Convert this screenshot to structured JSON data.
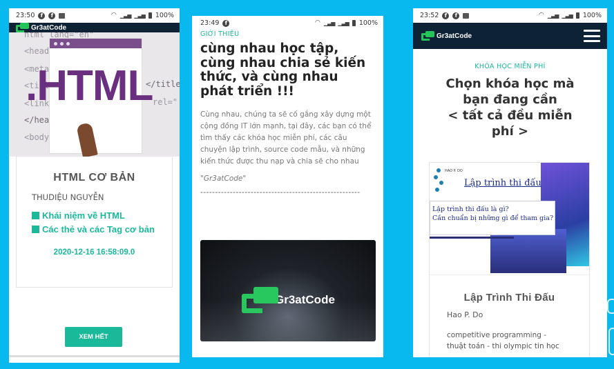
{
  "phone1": {
    "status": {
      "time": "23:50",
      "battery": "100%"
    },
    "brand": "Gr3atCode",
    "hero": {
      "big_text": ".HTML",
      "code_lines": [
        "html lang=\"en\"",
        "<head>",
        "<meta",
        "<title",
        "<link",
        "</head>",
        "<body",
        "</title",
        "rel=\""
      ]
    },
    "card": {
      "title": "HTML CƠ BẢN",
      "author": "THUDIỆU NGUYỄN",
      "links": [
        "Khái niệm về HTML",
        "Các thẻ và các Tag cơ bản"
      ],
      "date": "2020-12-16 16:58:09.0"
    },
    "more_button": "XEM HẾT"
  },
  "phone2": {
    "status": {
      "time": "23:49",
      "battery": "100%"
    },
    "section_label": "GIỚI THIỆU",
    "title": "cùng nhau học tập, cùng nhau chia sẻ kiến thức, và cùng nhau phát triển !!!",
    "paragraph": "Cùng nhau, chúng ta sẽ cố gắng xây dựng một cộng đồng IT lớn mạnh, tại đây, các bạn có thể tìm thấy các khóa học miễn phí, các câu chuyện lập trình, source code mẫu, và những kiến thức được thu nạp và chia sẽ cho nhau",
    "quote": "\"Gr3atCode\"",
    "divider": "------------------------------------------------------",
    "image_logo": "Gr3atCode"
  },
  "phone3": {
    "status": {
      "time": "23:52",
      "battery": "100%"
    },
    "brand": "Gr3atCode",
    "section_label": "KHÓA HỌC MIỄN PHÍ",
    "title_lines": [
      "Chọn khóa học mà",
      "bạn đang cần",
      "< tất cả đều miễn",
      "phí >"
    ],
    "card": {
      "image_brand": "HAO P. DO",
      "image_title": "Lập trình thi đấu",
      "image_question_1": "Lập trình thi đấu là gì?",
      "image_question_2": "Cần chuẩn bị những gì để tham gia?",
      "title": "Lập Trình Thi Đấu",
      "author": "Hao P. Do",
      "desc_1": "competitive programming -",
      "desc_2": "thuật toán - thi olympic tin học"
    }
  },
  "colors": {
    "background": "#07b9ee",
    "accent": "#19b99a",
    "brand_bar": "#0d2235",
    "logo_green": "#23c45a"
  },
  "icons": [
    "facebook-icon",
    "image-icon",
    "wifi-icon",
    "signal-icon",
    "battery-icon",
    "menu-icon"
  ]
}
